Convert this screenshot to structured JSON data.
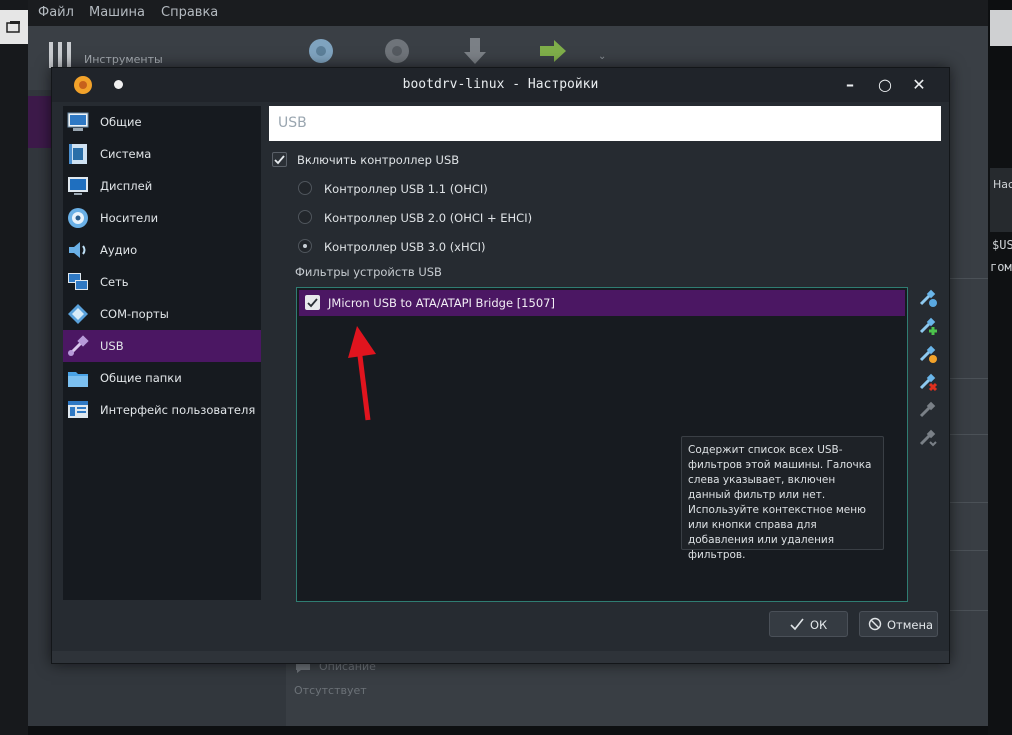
{
  "menubar": {
    "file": "Файл",
    "machine": "Машина",
    "help": "Справка"
  },
  "background": {
    "tools_label": "Инструменты",
    "description_label": "Описание",
    "description_value": "Отсутствует",
    "right_text_1": "$US",
    "right_text_2": "гом",
    "right_box_text": "Нас"
  },
  "dialog": {
    "title": "bootdrv-linux - Настройки",
    "controls": {
      "minimize": "–",
      "maximize": "○",
      "close": "✕"
    }
  },
  "sidebar": {
    "items": [
      {
        "label": "Общие",
        "icon": "monitor-icon"
      },
      {
        "label": "Система",
        "icon": "chip-icon"
      },
      {
        "label": "Дисплей",
        "icon": "display-icon"
      },
      {
        "label": "Носители",
        "icon": "disk-icon"
      },
      {
        "label": "Аудио",
        "icon": "speaker-icon"
      },
      {
        "label": "Сеть",
        "icon": "network-icon"
      },
      {
        "label": "COM-порты",
        "icon": "serial-port-icon"
      },
      {
        "label": "USB",
        "icon": "usb-icon",
        "active": true
      },
      {
        "label": "Общие папки",
        "icon": "folder-icon"
      },
      {
        "label": "Интерфейс пользователя",
        "icon": "ui-window-icon"
      }
    ]
  },
  "usb": {
    "heading": "USB",
    "enable_controller": {
      "label": "Включить контроллер USB",
      "checked": true
    },
    "controllers": [
      {
        "label": "Контроллер USB 1.1 (OHCI)",
        "selected": false
      },
      {
        "label": "Контроллер USB 2.0 (OHCI + EHCI)",
        "selected": false
      },
      {
        "label": "Контроллер USB 3.0 (xHCI)",
        "selected": true
      }
    ],
    "filters_label": "Фильтры устройств USB",
    "filters": [
      {
        "label": "JMicron USB to ATA/ATAPI Bridge [1507]",
        "checked": true
      }
    ],
    "tooltip": "Содержит список всех USB-фильтров этой машины. Галочка слева указывает, включен данный фильтр или нет. Используйте контекстное меню или кнопки справа для добавления или удаления фильтров."
  },
  "buttons": {
    "ok": "ОК",
    "cancel": "Отмена"
  },
  "colors": {
    "accent": "#4b1763",
    "dialog_bg": "#262b31",
    "list_border": "#2f7d72",
    "arrow": "#e0141e"
  }
}
